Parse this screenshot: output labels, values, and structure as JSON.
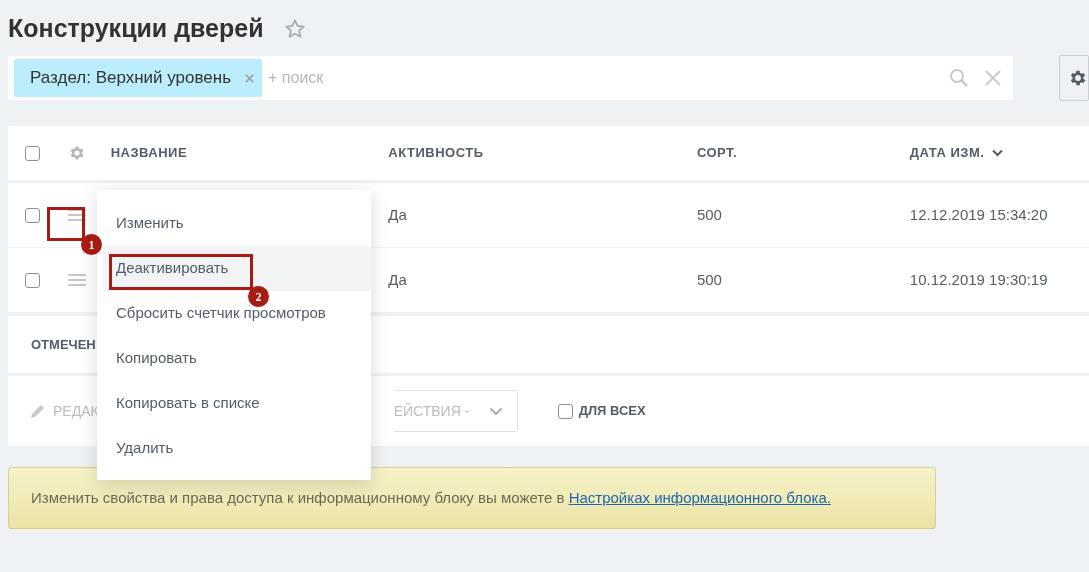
{
  "title": "Конструкции дверей",
  "filter": {
    "chips": [
      {
        "label": "Раздел: Верхний уровень"
      }
    ],
    "placeholder": "+ поиск"
  },
  "table": {
    "select_all": {
      "checked": false
    },
    "columns": [
      {
        "label": "НАЗВАНИЕ",
        "sorted": false
      },
      {
        "label": "АКТИВНОСТЬ",
        "sorted": false
      },
      {
        "label": "СОРТ.",
        "sorted": false
      },
      {
        "label": "ДАТА ИЗМ.",
        "sorted": true
      }
    ],
    "rows": [
      {
        "checked": false,
        "active": "Да",
        "sort": "500",
        "modified": "12.12.2019 15:34:20"
      },
      {
        "checked": false,
        "active": "Да",
        "sort": "500",
        "modified": "10.12.2019 19:30:19"
      }
    ]
  },
  "selection_label": "ОТМЕЧЕН",
  "actions": {
    "edit": {
      "label": "РЕДАК",
      "disabled": true
    },
    "dropdown": "ЕЙСТВИЯ -",
    "for_all": {
      "label": "ДЛЯ ВСЕХ",
      "checked": false
    }
  },
  "context_menu": {
    "items": [
      {
        "label": "Изменить",
        "selected": false
      },
      {
        "label": "Деактивировать",
        "selected": true
      },
      {
        "label": "Сбросить счетчик просмотров",
        "selected": false
      },
      {
        "label": "Копировать",
        "selected": false
      },
      {
        "label": "Копировать в списке",
        "selected": false
      },
      {
        "label": "Удалить",
        "selected": false
      }
    ]
  },
  "annotations": [
    {
      "label": "1"
    },
    {
      "label": "2"
    }
  ],
  "info": {
    "text": "Изменить свойства и права доступа к информационному блоку вы можете в ",
    "link": "Настройках информационного блока."
  }
}
